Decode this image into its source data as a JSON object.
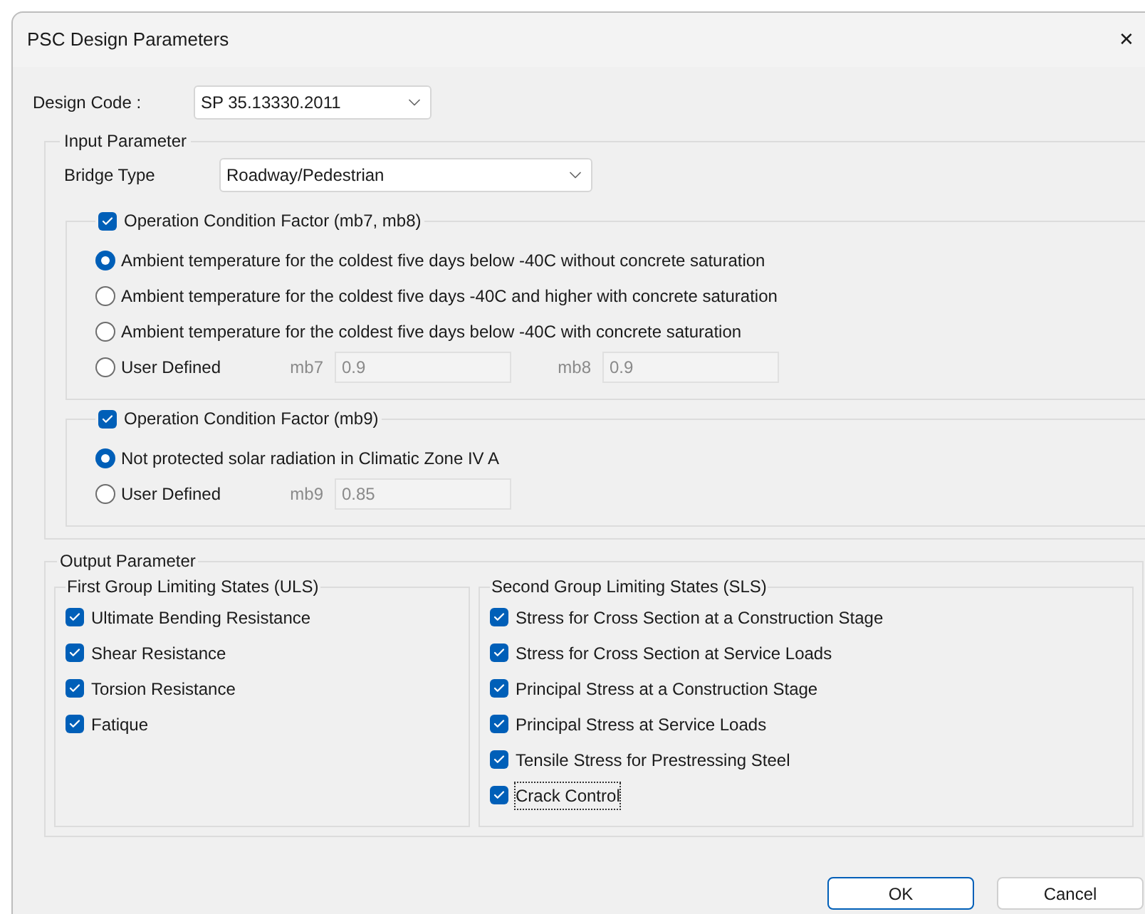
{
  "window": {
    "title": "PSC Design Parameters",
    "close": "✕"
  },
  "design_code": {
    "label": "Design Code :",
    "value": "SP 35.13330.2011"
  },
  "input_parameter": {
    "title": "Input Parameter",
    "bridge_type": {
      "label": "Bridge Type",
      "value": "Roadway/Pedestrian"
    },
    "factor_groups": [
      {
        "title": "Operation Condition Factor (mb7, mb8)",
        "checked": true,
        "options": [
          {
            "kind": "radio",
            "label": "Ambient temperature for the coldest five days below -40C without concrete saturation",
            "selected": true
          },
          {
            "kind": "radio",
            "label": "Ambient temperature for the coldest five days -40C and higher with concrete saturation",
            "selected": false
          },
          {
            "kind": "radio",
            "label": "Ambient temperature for the coldest five days below -40C with concrete saturation",
            "selected": false
          },
          {
            "kind": "user_defined",
            "label": "User Defined",
            "selected": false,
            "fields": [
              {
                "label": "mb7",
                "value": "0.9",
                "disabled": true
              },
              {
                "label": "mb8",
                "value": "0.9",
                "disabled": true
              }
            ]
          }
        ]
      },
      {
        "title": "Operation Condition Factor (mb9)",
        "checked": true,
        "options": [
          {
            "kind": "radio",
            "label": "Not protected solar radiation in Climatic Zone IV A",
            "selected": true
          },
          {
            "kind": "user_defined",
            "label": "User Defined",
            "selected": false,
            "fields": [
              {
                "label": "mb9",
                "value": "0.85",
                "disabled": true
              }
            ]
          }
        ]
      }
    ]
  },
  "output_parameter": {
    "title": "Output Parameter",
    "groups": [
      {
        "title": "First Group Limiting States (ULS)",
        "items": [
          {
            "label": "Ultimate Bending Resistance",
            "checked": true,
            "focused": false
          },
          {
            "label": "Shear Resistance",
            "checked": true,
            "focused": false
          },
          {
            "label": "Torsion Resistance",
            "checked": true,
            "focused": false
          },
          {
            "label": "Fatique",
            "checked": true,
            "focused": false
          }
        ]
      },
      {
        "title": "Second Group Limiting States (SLS)",
        "items": [
          {
            "label": "Stress for Cross Section at a Construction Stage",
            "checked": true,
            "focused": false
          },
          {
            "label": "Stress for Cross Section at Service Loads",
            "checked": true,
            "focused": false
          },
          {
            "label": "Principal Stress at a Construction Stage",
            "checked": true,
            "focused": false
          },
          {
            "label": "Principal Stress at Service Loads",
            "checked": true,
            "focused": false
          },
          {
            "label": "Tensile Stress for Prestressing Steel",
            "checked": true,
            "focused": false
          },
          {
            "label": "Crack Control",
            "checked": true,
            "focused": true
          }
        ]
      }
    ]
  },
  "buttons": [
    {
      "label": "OK",
      "default": true
    },
    {
      "label": "Cancel",
      "default": false
    }
  ]
}
